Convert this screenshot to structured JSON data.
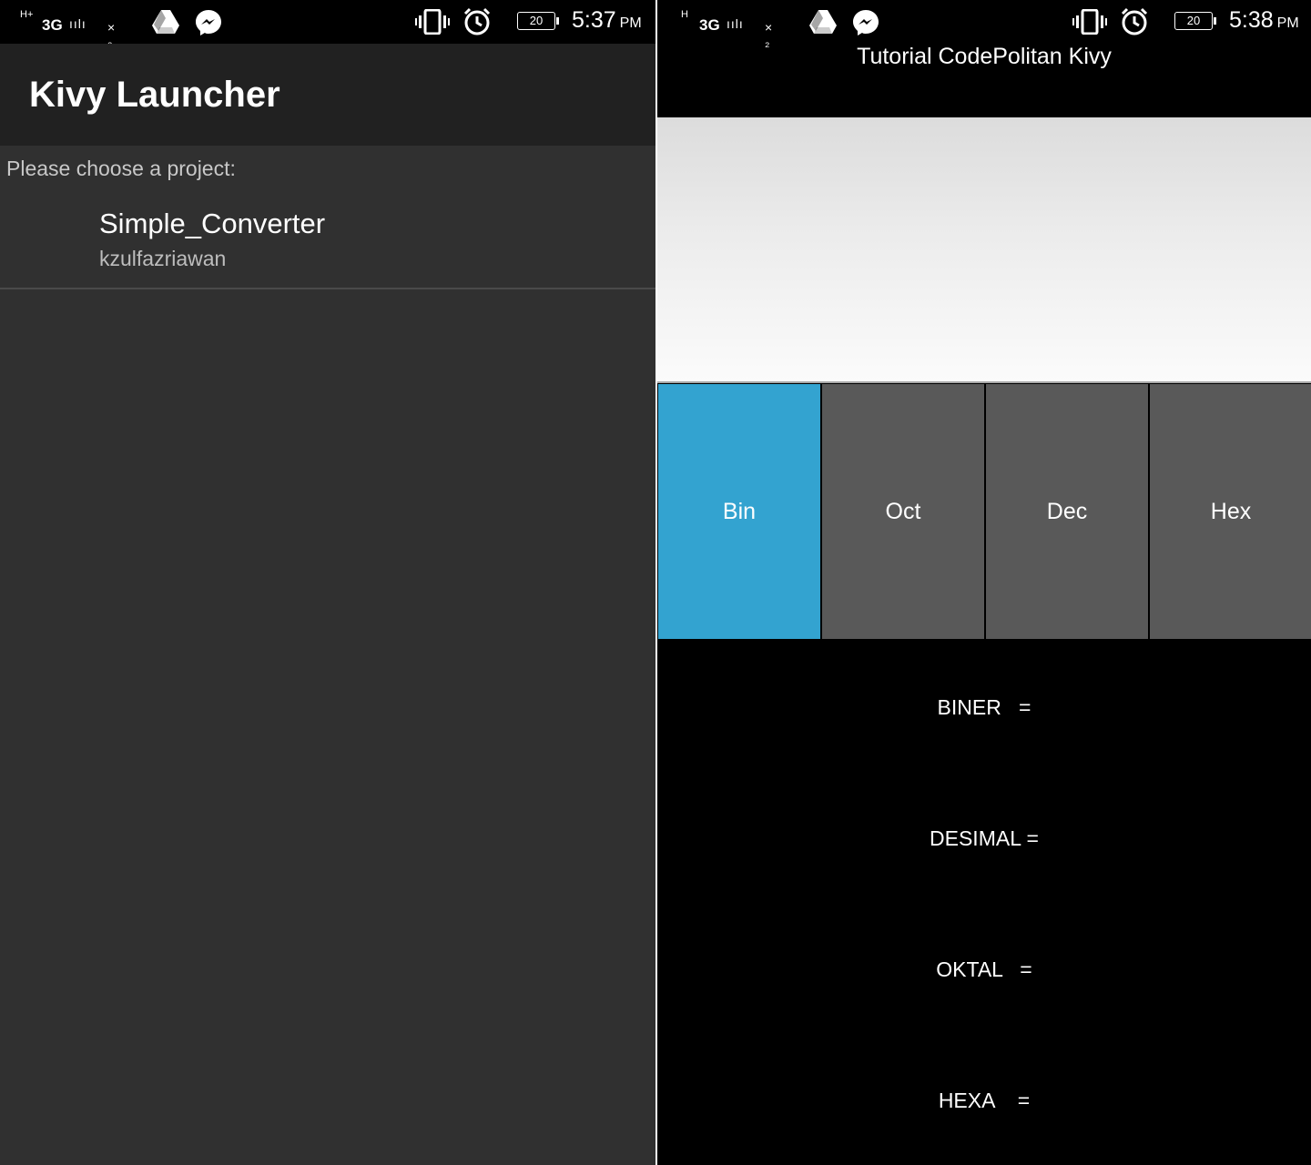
{
  "left_screen": {
    "status": {
      "network_badge": "H+",
      "network_type": "3G",
      "sim_label": "× ₂",
      "battery": "20",
      "time": "5:37",
      "ampm": "PM"
    },
    "app_title": "Kivy Launcher",
    "prompt": "Please choose a project:",
    "projects": [
      {
        "name": "Simple_Converter",
        "author": "kzulfazriawan"
      }
    ]
  },
  "right_screen": {
    "status": {
      "network_badge": "H",
      "network_type": "3G",
      "sim_label": "× ₂",
      "battery": "20",
      "time": "5:38",
      "ampm": "PM"
    },
    "title": "Tutorial CodePolitan Kivy",
    "input_value": "",
    "buttons": [
      "Bin",
      "Oct",
      "Dec",
      "Hex"
    ],
    "active_button": "Bin",
    "results": [
      "BINER   =",
      "DESIMAL =",
      "OKTAL   =",
      "HEXA    ="
    ]
  },
  "colors": {
    "launcher_bg": "#303030",
    "launcher_appbar": "#212121",
    "button_active": "#33a3d0",
    "button_default": "#595959"
  },
  "icons": {
    "status": [
      "signal-icon",
      "drive-icon",
      "messenger-icon",
      "vibrate-icon",
      "alarm-icon",
      "battery-icon"
    ]
  }
}
